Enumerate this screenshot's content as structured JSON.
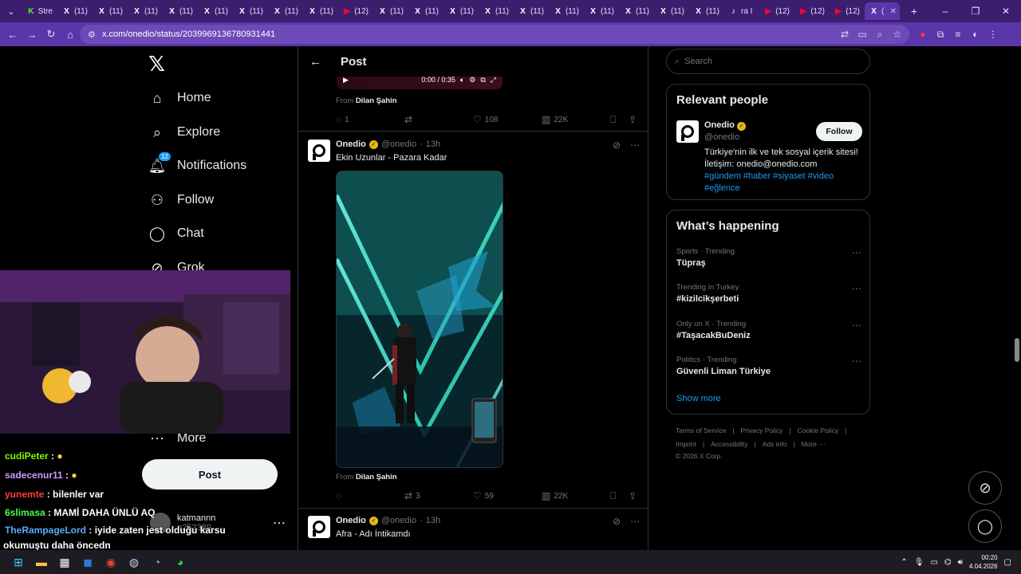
{
  "browser": {
    "tabs": [
      {
        "label": "Stre",
        "icon": "kick-icon",
        "color": "#53fc18"
      },
      {
        "label": "(11)",
        "icon": "x-icon"
      },
      {
        "label": "(11)",
        "icon": "x-icon"
      },
      {
        "label": "(11)",
        "icon": "x-icon"
      },
      {
        "label": "(11)",
        "icon": "x-icon"
      },
      {
        "label": "(11)",
        "icon": "x-icon"
      },
      {
        "label": "(11)",
        "icon": "x-icon"
      },
      {
        "label": "(11)",
        "icon": "x-icon"
      },
      {
        "label": "(11)",
        "icon": "x-icon"
      },
      {
        "label": "(12)",
        "icon": "youtube-icon",
        "color": "#ff0033"
      },
      {
        "label": "(11)",
        "icon": "x-icon"
      },
      {
        "label": "(11)",
        "icon": "x-icon"
      },
      {
        "label": "(11)",
        "icon": "x-icon"
      },
      {
        "label": "(11)",
        "icon": "x-icon"
      },
      {
        "label": "(11)",
        "icon": "x-icon"
      },
      {
        "label": "(11)",
        "icon": "x-icon"
      },
      {
        "label": "(11)",
        "icon": "x-icon"
      },
      {
        "label": "(11)",
        "icon": "x-icon"
      },
      {
        "label": "(11)",
        "icon": "x-icon"
      },
      {
        "label": "(11)",
        "icon": "x-icon"
      },
      {
        "label": "ra I",
        "icon": "tiktok-icon"
      },
      {
        "label": "(12)",
        "icon": "youtube-icon",
        "color": "#ff0033"
      },
      {
        "label": "(12)",
        "icon": "youtube-icon",
        "color": "#ff0033"
      },
      {
        "label": "(12)",
        "icon": "youtube-icon",
        "color": "#ff0033"
      },
      {
        "label": "(",
        "icon": "x-icon",
        "active": true
      }
    ],
    "url": "x.com/onedio/status/2039969136780931441",
    "accent": "#5b36a8"
  },
  "nav": {
    "items": [
      {
        "label": "Home",
        "icon": "home-icon"
      },
      {
        "label": "Explore",
        "icon": "search-icon"
      },
      {
        "label": "Notifications",
        "icon": "bell-icon",
        "badge": "12"
      },
      {
        "label": "Follow",
        "icon": "person-plus-icon"
      },
      {
        "label": "Chat",
        "icon": "chat-icon"
      },
      {
        "label": "Grok",
        "icon": "grok-icon"
      },
      {
        "label": "More",
        "icon": "more-circle-icon"
      }
    ],
    "post_label": "Post",
    "account": {
      "name": "katmannn",
      "handle": "n252389"
    }
  },
  "main": {
    "header_title": "Post",
    "prev_media": {
      "time": "0:00 / 0:35"
    },
    "prev_from": "From",
    "prev_from_name": "Dilan Şahin",
    "prev_stats": {
      "replies": "1",
      "reposts": "",
      "likes": "108",
      "views": "22K"
    },
    "tweet1": {
      "name": "Onedio",
      "handle": "@onedio",
      "time": "13h",
      "text": "Ekin Uzunlar - Pazara Kadar",
      "from": "From",
      "from_name": "Dilan Şahin",
      "stats": {
        "replies": "",
        "reposts": "3",
        "likes": "59",
        "views": "22K"
      }
    },
    "tweet2": {
      "name": "Onedio",
      "handle": "@onedio",
      "time": "13h",
      "text": "Afra - Adı İntikamdı"
    }
  },
  "right": {
    "search_placeholder": "Search",
    "relevant": {
      "title": "Relevant people",
      "name": "Onedio",
      "handle": "@onedio",
      "bio": "Türkiye'nin ilk ve tek sosyal içerik sitesi! İletişim: onedio@onedio.com",
      "tags": "#gündem #haber #siyaset #video #eğlence",
      "follow_label": "Follow"
    },
    "happening": {
      "title": "What’s happening",
      "trends": [
        {
          "category": "Sports · Trending",
          "name": "Tüpraş"
        },
        {
          "category": "Trending in Turkey",
          "name": "#kizilcikşerbeti"
        },
        {
          "category": "Only on X · Trending",
          "name": "#TaşacakBuDeniz"
        },
        {
          "category": "Politics · Trending",
          "name": "Güvenli Liman Türkiye"
        }
      ],
      "show_more": "Show more"
    },
    "footer": {
      "row1": [
        "Terms of Service",
        "Privacy Policy",
        "Cookie Policy"
      ],
      "row2": [
        "Imprint",
        "Accessibility",
        "Ads info",
        "More ···"
      ],
      "copyright": "© 2026 X Corp."
    }
  },
  "chat": [
    {
      "user": "cudiPeter",
      "msg": "",
      "color": "#7cfc00"
    },
    {
      "user": "sadecenur11",
      "msg": "",
      "color": "#c89bff"
    },
    {
      "user": "yunemte",
      "msg": "bilenler var",
      "color": "#ff3b3b"
    },
    {
      "user": "6slimasa",
      "msg": "MAMİ DAHA ÜNLÜ AQ",
      "color": "#4cff4c"
    },
    {
      "user": "TheRampageLord",
      "msg": "iyide zaten jest olduğu karsu",
      "color": "#5aa9ff"
    },
    {
      "user": "",
      "msg": "okumuştu daha öncedn",
      "color": "#ffffff"
    }
  ],
  "taskbar": {
    "time": "00:20",
    "date": "4.04.2026"
  }
}
